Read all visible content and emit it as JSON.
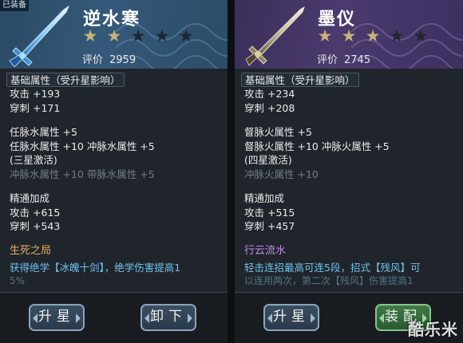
{
  "left": {
    "equipped_tag": "已装备",
    "name": "逆水寒",
    "stars_total": 5,
    "stars_lit": 2,
    "rating_label": "评价",
    "rating_value": "2959",
    "section_label": "基础属性（受升星影响）",
    "base_stats": [
      "攻击 +193",
      "穿刺 +171"
    ],
    "meridian_lines": [
      {
        "text": "任脉水属性 +5",
        "dim": false
      },
      {
        "text": "任脉水属性 +10  冲脉水属性 +5",
        "dim": false
      },
      {
        "text": "(三星激活)",
        "dim": false
      },
      {
        "text": "冲脉水属性 +10  带脉水属性 +5",
        "dim": true
      }
    ],
    "mastery_title": "精通加成",
    "mastery_stats": [
      "攻击 +615",
      "穿刺 +543"
    ],
    "skill_title": "生死之局",
    "skill_desc": "获得绝学【冰魄十剑】，绝学伤害提高1",
    "skill_desc_cut": "5%",
    "buttons": {
      "upgrade": "升星",
      "unequip": "卸下"
    }
  },
  "right": {
    "name": "墨仪",
    "stars_total": 5,
    "stars_lit": 3,
    "rating_label": "评价",
    "rating_value": "2745",
    "section_label": "基础属性（受升星影响）",
    "base_stats": [
      "攻击 +234",
      "穿刺 +208"
    ],
    "meridian_lines": [
      {
        "text": "督脉火属性 +5",
        "dim": false
      },
      {
        "text": "督脉火属性 +10  冲脉火属性 +5",
        "dim": false
      },
      {
        "text": "(四星激活)",
        "dim": false
      },
      {
        "text": "冲脉火属性 +10",
        "dim": true
      }
    ],
    "mastery_title": "精通加成",
    "mastery_stats": [
      "攻击 +515",
      "穿刺 +457"
    ],
    "skill_title": "行云流水",
    "skill_desc": "轻击连招最高可连5段，招式【残风】可",
    "skill_desc_cut": "以连用两次，第二次【残风】伤害提高1",
    "buttons": {
      "upgrade": "升星",
      "equip": "装配"
    }
  },
  "watermark": "酷乐米",
  "colors": {
    "star_lit": "#c9b27a",
    "skill_left": "#e0b064",
    "skill_right": "#c38be8",
    "skill_desc": "#6fc3ea"
  }
}
